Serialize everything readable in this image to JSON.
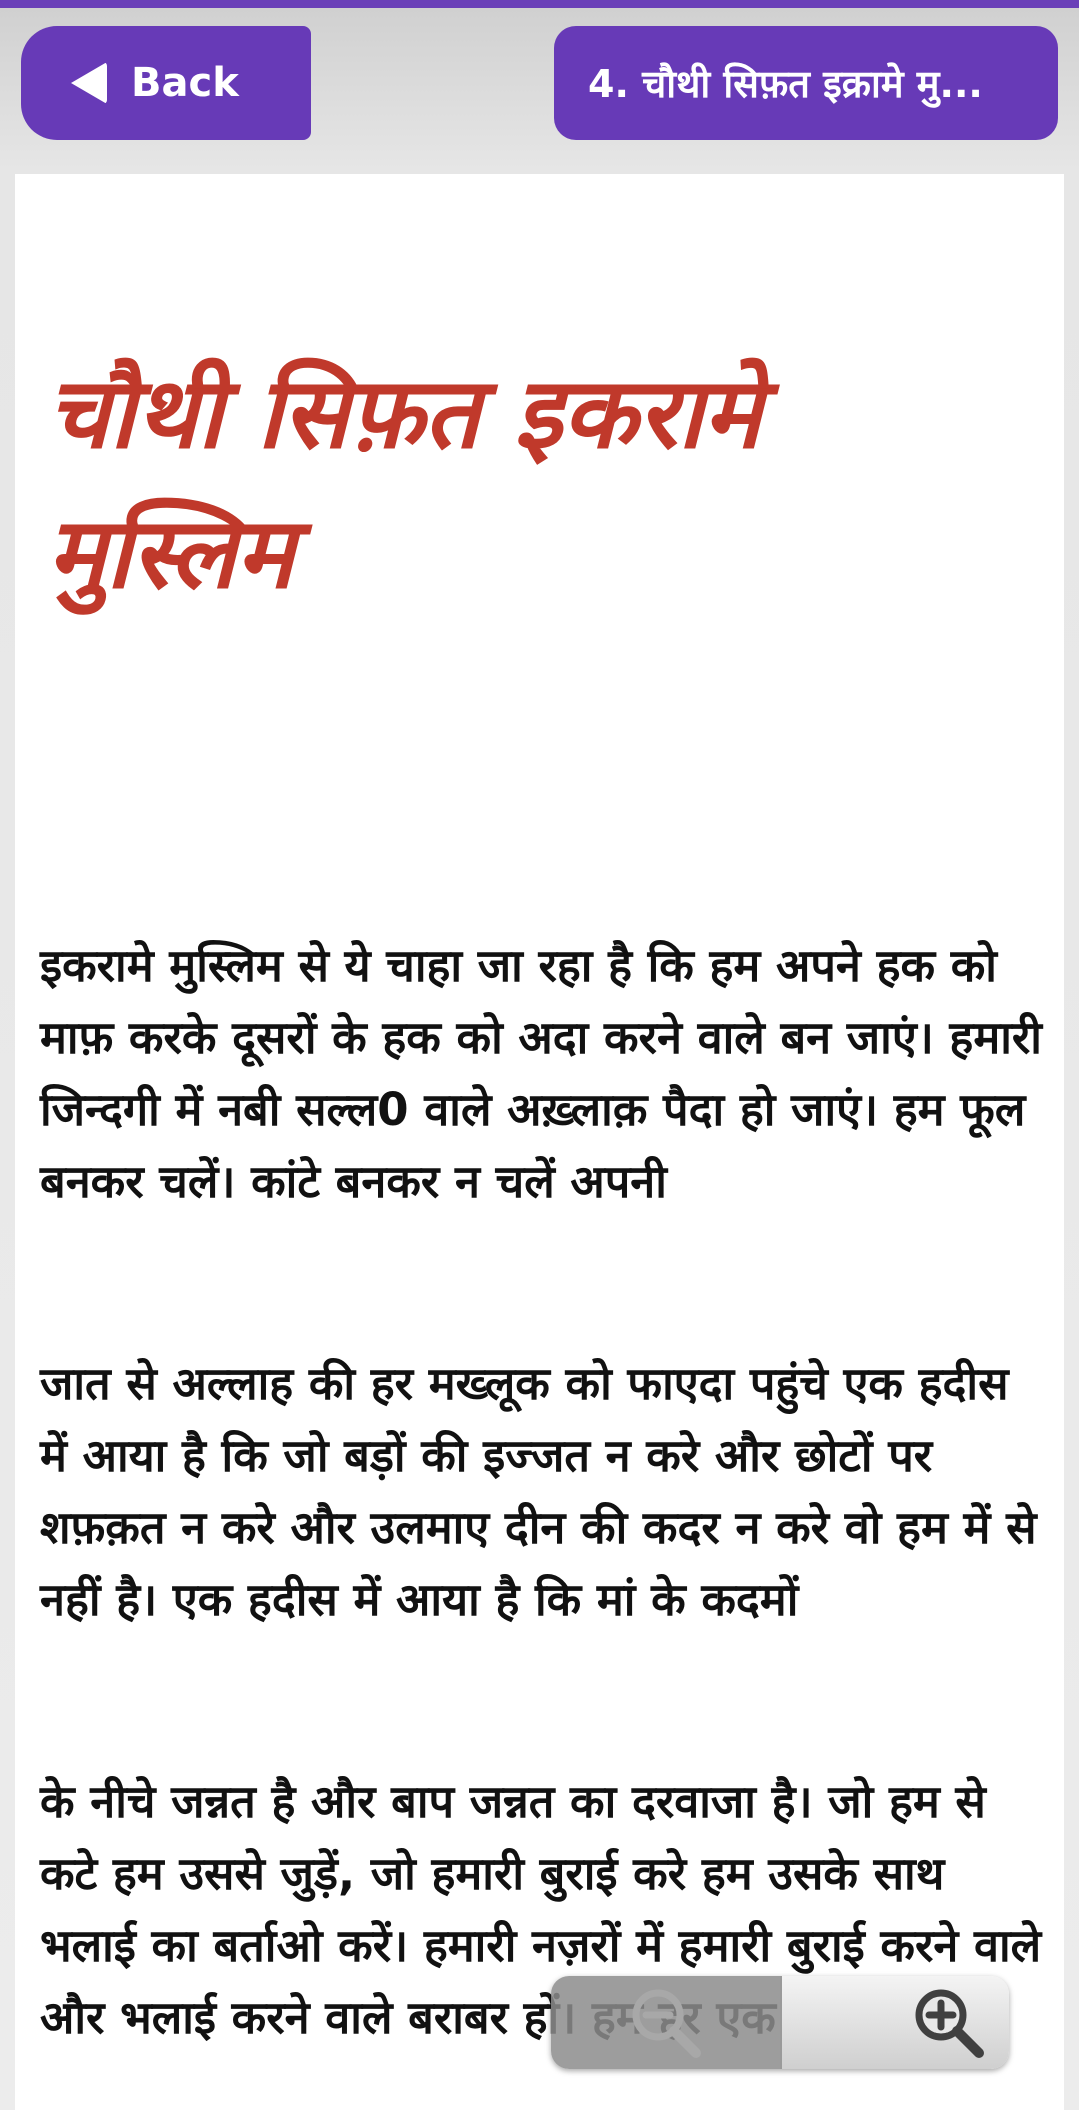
{
  "header": {
    "back_label": "Back",
    "title": "4. चौथी सिफ़त इक्रामे मु..."
  },
  "article": {
    "heading": "चौथी सिफ़त इकरामे मुस्लिम",
    "paragraphs": [
      "इकरामे मुस्लिम से ये चाहा जा रहा है कि हम अपने हक को माफ़ करके दूसरों के हक को अदा करने वाले बन जाएं। हमारी जिन्दगी में नबी सल्ल0 वाले अख़्लाक़ पैदा हो जाएं। हम फूल बनकर चलें। कांटे बनकर न चलें अपनी",
      "जात से अल्लाह की हर मख्लूक को फाएदा पहुंचे एक हदीस में आया है कि जो बड़ों की इज्जत न करे और छोटों पर शफ़क़त न करे और उलमाए दीन की कदर न करे वो हम में से नहीं है। एक हदीस में आया है कि मां के कदमों",
      "के नीचे जन्नत है और बाप जन्नत का दरवाजा है। जो हम से कटे हम उससे जुड़ें, जो हमारी बुराई करे हम उसके साथ भलाई का बर्ताओ करें। हमारी नज़रों में हमारी बुराई करने वाले और भलाई करने वाले बराबर हों। हम हर एक"
    ]
  },
  "zoom": {
    "out_icon": "zoom-out-icon",
    "in_icon": "zoom-in-icon"
  },
  "colors": {
    "accent": "#673ab7",
    "heading": "#c0392b"
  }
}
